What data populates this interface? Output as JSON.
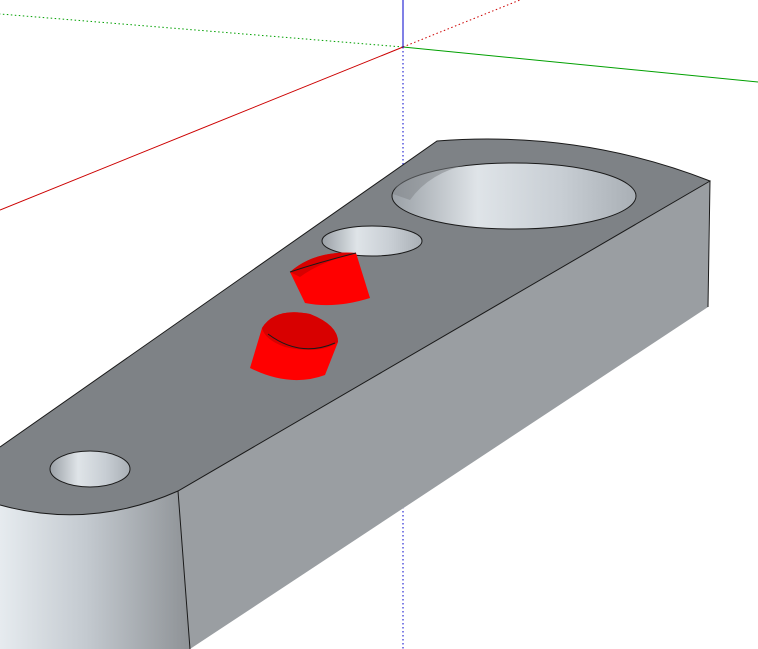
{
  "viewport": {
    "background": "#ffffff",
    "axes": {
      "x_axis_color": "#cc0000",
      "y_axis_color": "#00a000",
      "z_axis_color": "#0000cc"
    },
    "model": {
      "top_face_color": "#7e8286",
      "side_face_color": "#9a9ea2",
      "curved_face_color": "#b8bec4",
      "hole_color": "#c8ced4",
      "edge_color": "#1a1a1a",
      "selected_color": "#ff0000",
      "selected_dark_color": "#d80000"
    }
  }
}
